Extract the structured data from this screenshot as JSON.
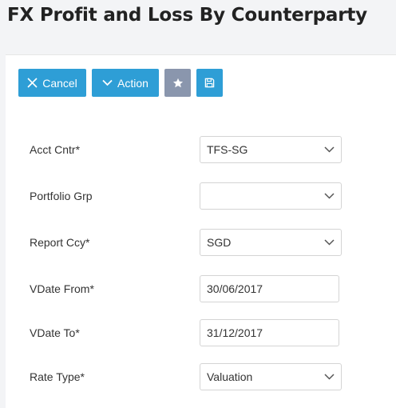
{
  "page": {
    "title": "FX Profit and Loss By Counterparty"
  },
  "toolbar": {
    "cancel_label": "Cancel",
    "action_label": "Action",
    "favorite_icon": "star-icon",
    "save_icon": "save-icon"
  },
  "form": {
    "acct_cntr": {
      "label": "Acct Cntr*",
      "value": "TFS-SG"
    },
    "portfolio_grp": {
      "label": "Portfolio Grp",
      "value": ""
    },
    "report_ccy": {
      "label": "Report Ccy*",
      "value": "SGD"
    },
    "vdate_from": {
      "label": "VDate From*",
      "value": "30/06/2017"
    },
    "vdate_to": {
      "label": "VDate To*",
      "value": "31/12/2017"
    },
    "rate_type": {
      "label": "Rate Type*",
      "value": "Valuation"
    }
  },
  "colors": {
    "primary_button": "#2e9ed6",
    "secondary_button": "#8a96ad",
    "background": "#f3f4f6",
    "panel": "#ffffff"
  }
}
